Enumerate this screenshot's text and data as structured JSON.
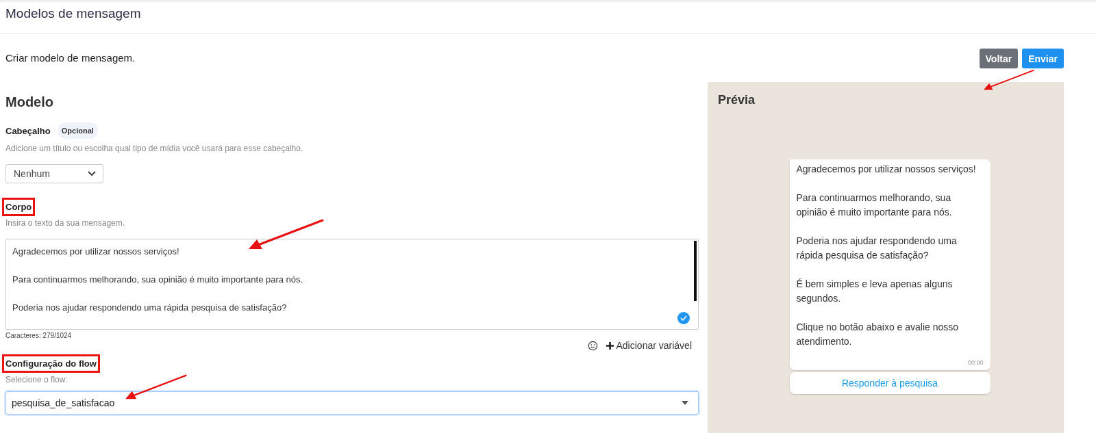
{
  "page": {
    "title": "Modelos de mensagem"
  },
  "subtitle": "Criar modelo de mensagem.",
  "actions": [
    {
      "kind": "secondary",
      "label": "Voltar",
      "arrow": false
    },
    {
      "kind": "primary",
      "label": "Enviar",
      "arrow": true
    }
  ],
  "form": {
    "title": "Modelo",
    "header": {
      "label": "Cabeçalho",
      "label_highlighted": false,
      "badge": "Opcional",
      "hint": "Adicione um título ou escolha qual tipo de mídia você usará para esse cabeçalho.",
      "select_value": "Nenhum"
    },
    "body": {
      "label": "Corpo",
      "label_highlighted": true,
      "hint": "Insira o texto da sua mensagem.",
      "value": "Agradecemos por utilizar nossos serviços!\n\nPara continuarmos melhorando, sua opinião é muito importante para nós.\n\nPoderia nos ajudar respondendo uma rápida pesquisa de satisfação?",
      "arrow": true,
      "valid": true,
      "counter": "Caracteres: 279/1024",
      "add_variable": "Adicionar variável"
    },
    "flow": {
      "label": "Configuração do flow",
      "label_highlighted": true,
      "hint": "Selecione o flow:",
      "select_value": "pesquisa_de_satisfacao",
      "focused": true,
      "arrow": true
    }
  },
  "preview": {
    "title": "Prévia",
    "paragraphs": [
      "Agradecemos por utilizar nossos serviços!",
      "Para continuarmos melhorando, sua opinião é muito importante para nós.",
      "Poderia nos ajudar respondendo uma rápida pesquisa de satisfação?",
      "É bem simples e leva apenas alguns segundos.",
      "Clique no botão abaixo e avalie nosso atendimento."
    ],
    "time": "00:00",
    "button": "Responder à pesquisa"
  }
}
